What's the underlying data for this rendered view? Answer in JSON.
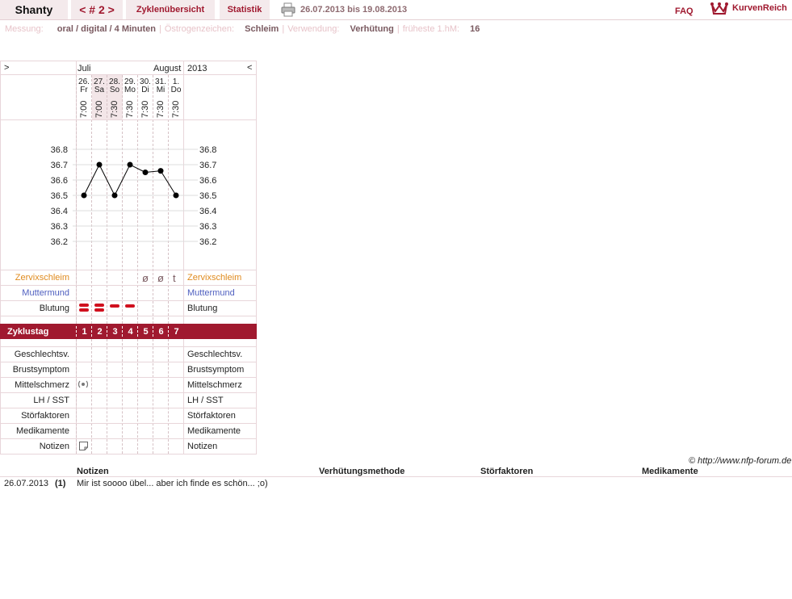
{
  "nav": {
    "brand": "Shanty",
    "cycle": "< # 2 >",
    "overview": "Zyklenübersicht",
    "stats": "Statistik",
    "range": "26.07.2013 bis 19.08.2013",
    "faq": "FAQ",
    "logo": "KurvenReich"
  },
  "info": {
    "messung_label": "Messung:",
    "messung_value": "oral / digital / 4 Minuten",
    "oestrogen_label": "Östrogenzeichen:",
    "oestrogen_value": "Schleim",
    "verwendung_label": "Verwendung:",
    "verwendung_value": "Verhütung",
    "hm_label": "früheste 1.hM:",
    "hm_value": "16"
  },
  "chart": {
    "nav_left": ">",
    "nav_right": "<",
    "month1": "Juli",
    "month2": "August",
    "year": "2013",
    "days": [
      {
        "num": "26.",
        "wd": "Fr",
        "time": "7:00"
      },
      {
        "num": "27.",
        "wd": "Sa",
        "time": "7:00"
      },
      {
        "num": "28.",
        "wd": "So",
        "time": "7:30"
      },
      {
        "num": "29.",
        "wd": "Mo",
        "time": "7:30"
      },
      {
        "num": "30.",
        "wd": "Di",
        "time": "7:30"
      },
      {
        "num": "31.",
        "wd": "Mi",
        "time": "7:30"
      },
      {
        "num": "1.",
        "wd": "Do",
        "time": "7:30"
      }
    ],
    "temp_labels": [
      "36.8",
      "36.7",
      "36.6",
      "36.5",
      "36.4",
      "36.3",
      "36.2"
    ],
    "temps": [
      36.5,
      36.7,
      36.5,
      36.7,
      36.65,
      36.66,
      36.5
    ],
    "rows": {
      "zervix": "Zervixschleim",
      "muttermund": "Muttermund",
      "blutung": "Blutung",
      "zyklustag": "Zyklustag",
      "gv": "Geschlechtsv.",
      "brust": "Brustsymptom",
      "mittel": "Mittelschmerz",
      "lh": "LH / SST",
      "stoer": "Störfaktoren",
      "medi": "Medikamente",
      "notizen": "Notizen"
    },
    "zervix_marks": [
      "",
      "",
      "",
      "",
      "ø",
      "ø",
      "t"
    ],
    "bleeding": [
      2,
      2,
      1,
      1,
      0,
      0,
      0
    ],
    "cycle_days": [
      "1",
      "2",
      "3",
      "4",
      "5",
      "6",
      "7"
    ]
  },
  "colors": {
    "accent": "#a0192f",
    "zervix": "#e08a1e",
    "muttermund": "#5060c0"
  },
  "footer": {
    "copyright": "© http://www.nfp-forum.de",
    "col_notizen": "Notizen",
    "col_methode": "Verhütungsmethode",
    "col_stoer": "Störfaktoren",
    "col_medi": "Medikamente",
    "entry_date": "26.07.2013",
    "entry_num": "(1)",
    "entry_text": "Mir ist soooo übel... aber ich finde es schön... ;o)"
  }
}
